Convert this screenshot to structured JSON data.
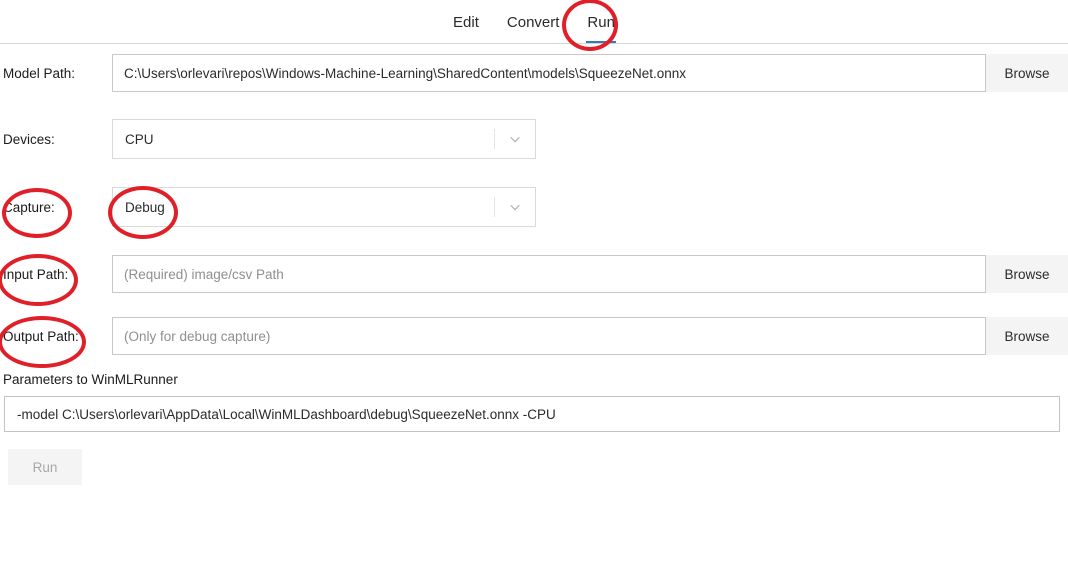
{
  "tabs": [
    {
      "label": "Edit",
      "active": false
    },
    {
      "label": "Convert",
      "active": false
    },
    {
      "label": "Run",
      "active": true
    }
  ],
  "fields": {
    "model_path": {
      "label": "Model Path:",
      "value": "C:\\Users\\orlevari\\repos\\Windows-Machine-Learning\\SharedContent\\models\\SqueezeNet.onnx",
      "placeholder": "",
      "browse_label": "Browse"
    },
    "devices": {
      "label": "Devices:",
      "value": "CPU",
      "chevron_icon": "chevron-down-icon"
    },
    "capture": {
      "label": "Capture:",
      "value": "Debug",
      "chevron_icon": "chevron-down-icon"
    },
    "input_path": {
      "label": "Input Path:",
      "value": "",
      "placeholder": "(Required) image/csv Path",
      "browse_label": "Browse"
    },
    "output_path": {
      "label": "Output Path:",
      "value": "",
      "placeholder": "(Only for debug capture)",
      "browse_label": "Browse"
    }
  },
  "parameters": {
    "label": "Parameters to WinMLRunner",
    "value": "-model C:\\Users\\orlevari\\AppData\\Local\\WinMLDashboard\\debug\\SqueezeNet.onnx -CPU"
  },
  "actions": {
    "run_label": "Run"
  },
  "colors": {
    "annotation_red": "#e02028",
    "active_tab_blue": "#2f7bbd",
    "button_grey": "#f4f4f4",
    "border_grey": "#c8c8c8"
  }
}
